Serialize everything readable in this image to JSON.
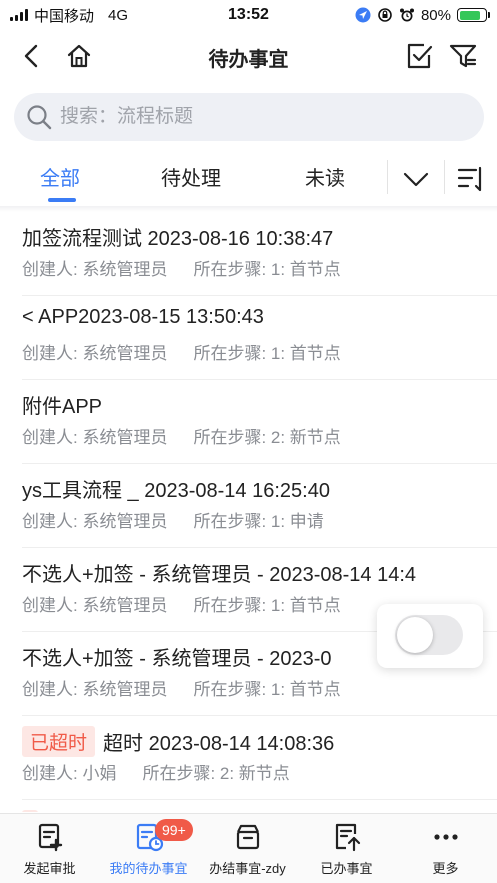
{
  "status_bar": {
    "carrier": "中国移动",
    "network": "4G",
    "time": "13:52",
    "battery": "80%"
  },
  "nav": {
    "title": "待办事宜",
    "icons": [
      "back-icon",
      "home-icon",
      "batch-check-icon",
      "filter-icon"
    ]
  },
  "search": {
    "placeholder": "搜索：流程标题"
  },
  "tabs": [
    {
      "label": "全部",
      "active": true
    },
    {
      "label": "待处理",
      "active": false
    },
    {
      "label": "未读",
      "active": false
    }
  ],
  "list": [
    {
      "title": "加签流程测试  2023-08-16 10:38:47",
      "creator": "创建人: 系统管理员",
      "step": "所在步骤: 1:  首节点"
    },
    {
      "title": "< APP2023-08-15 13:50:43",
      "creator": "创建人: 系统管理员",
      "step": "所在步骤: 1:  首节点"
    },
    {
      "title": "附件APP",
      "creator": "创建人: 系统管理员",
      "step": "所在步骤: 2:  新节点"
    },
    {
      "title": "ys工具流程 _ 2023-08-14 16:25:40",
      "creator": "创建人: 系统管理员",
      "step": "所在步骤: 1:  申请"
    },
    {
      "title": "不选人+加签  -  系统管理员  -  2023-08-14 14:4",
      "creator": "创建人: 系统管理员",
      "step": "所在步骤: 1:  首节点"
    },
    {
      "title": "不选人+加签  -  系统管理员  -  2023-0",
      "creator": "创建人: 系统管理员",
      "step": "所在步骤: 1:  首节点"
    },
    {
      "badge": "已超时",
      "title": "超时 2023-08-14 14:08:36",
      "creator": "创建人: 小娟",
      "step": "所在步骤: 2:  新节点"
    }
  ],
  "bottom_bar": {
    "items": [
      {
        "label": "发起审批",
        "icon": "start-approval-icon"
      },
      {
        "label": "我的待办事宜",
        "icon": "todo-icon",
        "badge": "99+",
        "active": true
      },
      {
        "label": "办结事宜-zdy",
        "icon": "archive-icon"
      },
      {
        "label": "已办事宜",
        "icon": "done-icon"
      },
      {
        "label": "更多",
        "icon": "more-icon"
      }
    ]
  },
  "colors": {
    "accent": "#3b7cf5",
    "overdue": "#f05a48",
    "overdue_bg": "#fde7e4",
    "meta_text": "#8a8d93",
    "search_bg": "#eef0f5"
  }
}
